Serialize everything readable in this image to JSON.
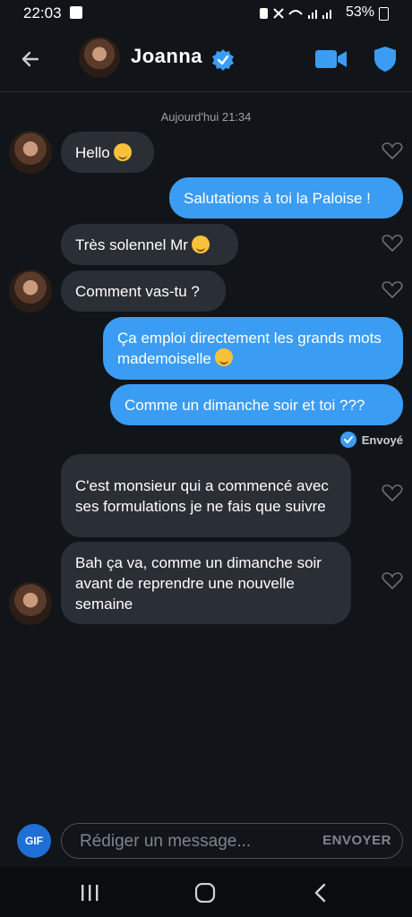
{
  "status_bar": {
    "time": "22:03",
    "battery": "53%"
  },
  "header": {
    "contact_name": "Joanna"
  },
  "chat": {
    "date_separator": "Aujourd'hui 21:34",
    "messages": [
      {
        "id": "m1",
        "direction": "in",
        "text": "Hello"
      },
      {
        "id": "m2",
        "direction": "out",
        "text": "Salutations à toi la Paloise !"
      },
      {
        "id": "m3",
        "direction": "in",
        "text": "Très solennel Mr"
      },
      {
        "id": "m4",
        "direction": "in",
        "text": "Comment vas-tu ?"
      },
      {
        "id": "m5",
        "direction": "out",
        "text": "Ça emploi directement les grands mots mademoiselle"
      },
      {
        "id": "m6",
        "direction": "out",
        "text": "Comme un dimanche soir et toi ???"
      },
      {
        "id": "m7",
        "direction": "in",
        "text": "C'est monsieur qui a commencé avec ses formulations  je ne fais que suivre"
      },
      {
        "id": "m8",
        "direction": "in",
        "text": "Bah ça va, comme un dimanche soir avant de reprendre une nouvelle semaine"
      }
    ],
    "sent_status": "Envoyé"
  },
  "composer": {
    "gif_label": "GIF",
    "placeholder": "Rédiger un message...",
    "send_label": "ENVOYER"
  },
  "colors": {
    "background": "#111418",
    "incoming": "#2a2e35",
    "outgoing": "#3b9cf3",
    "accent": "#1f6fd6"
  }
}
